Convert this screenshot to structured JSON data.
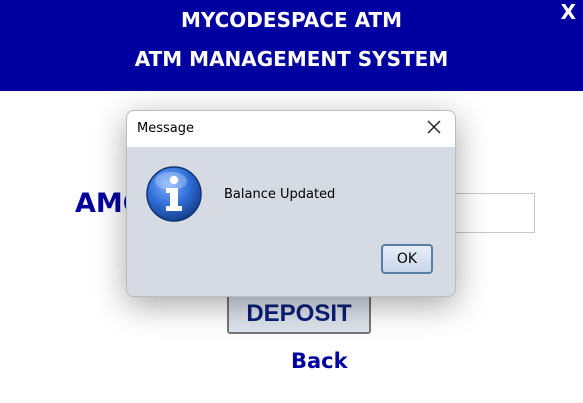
{
  "header": {
    "title_line1": "MYCODESPACE ATM",
    "title_line2": "ATM MANAGEMENT SYSTEM",
    "close_label": "X",
    "background_color": "#0000a0"
  },
  "form": {
    "amount_label": "AMOUNT",
    "amount_value": "",
    "deposit_label": "DEPOSIT",
    "back_label": "Back"
  },
  "dialog": {
    "title": "Message",
    "message": "Balance Updated",
    "ok_label": "OK",
    "icon": "info-icon"
  }
}
